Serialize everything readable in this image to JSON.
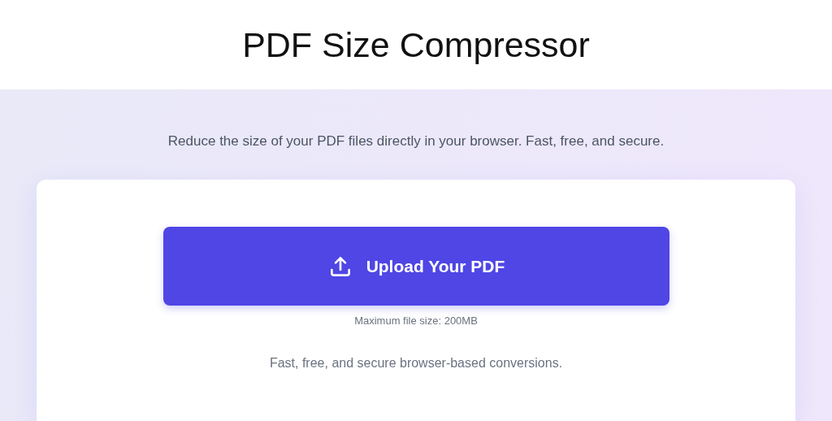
{
  "header": {
    "title": "PDF Size Compressor"
  },
  "subtitle": "Reduce the size of your PDF files directly in your browser. Fast, free, and secure.",
  "card": {
    "upload_button": "Upload Your PDF",
    "max_size": "Maximum file size: 200MB",
    "note": "Fast, free, and secure browser-based conversions."
  }
}
